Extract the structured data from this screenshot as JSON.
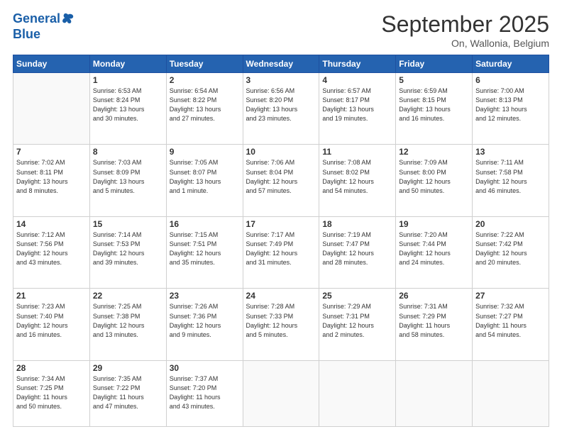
{
  "logo": {
    "line1": "General",
    "line2": "Blue"
  },
  "title": "September 2025",
  "subtitle": "On, Wallonia, Belgium",
  "weekdays": [
    "Sunday",
    "Monday",
    "Tuesday",
    "Wednesday",
    "Thursday",
    "Friday",
    "Saturday"
  ],
  "weeks": [
    [
      {
        "day": "",
        "info": ""
      },
      {
        "day": "1",
        "info": "Sunrise: 6:53 AM\nSunset: 8:24 PM\nDaylight: 13 hours\nand 30 minutes."
      },
      {
        "day": "2",
        "info": "Sunrise: 6:54 AM\nSunset: 8:22 PM\nDaylight: 13 hours\nand 27 minutes."
      },
      {
        "day": "3",
        "info": "Sunrise: 6:56 AM\nSunset: 8:20 PM\nDaylight: 13 hours\nand 23 minutes."
      },
      {
        "day": "4",
        "info": "Sunrise: 6:57 AM\nSunset: 8:17 PM\nDaylight: 13 hours\nand 19 minutes."
      },
      {
        "day": "5",
        "info": "Sunrise: 6:59 AM\nSunset: 8:15 PM\nDaylight: 13 hours\nand 16 minutes."
      },
      {
        "day": "6",
        "info": "Sunrise: 7:00 AM\nSunset: 8:13 PM\nDaylight: 13 hours\nand 12 minutes."
      }
    ],
    [
      {
        "day": "7",
        "info": "Sunrise: 7:02 AM\nSunset: 8:11 PM\nDaylight: 13 hours\nand 8 minutes."
      },
      {
        "day": "8",
        "info": "Sunrise: 7:03 AM\nSunset: 8:09 PM\nDaylight: 13 hours\nand 5 minutes."
      },
      {
        "day": "9",
        "info": "Sunrise: 7:05 AM\nSunset: 8:07 PM\nDaylight: 13 hours\nand 1 minute."
      },
      {
        "day": "10",
        "info": "Sunrise: 7:06 AM\nSunset: 8:04 PM\nDaylight: 12 hours\nand 57 minutes."
      },
      {
        "day": "11",
        "info": "Sunrise: 7:08 AM\nSunset: 8:02 PM\nDaylight: 12 hours\nand 54 minutes."
      },
      {
        "day": "12",
        "info": "Sunrise: 7:09 AM\nSunset: 8:00 PM\nDaylight: 12 hours\nand 50 minutes."
      },
      {
        "day": "13",
        "info": "Sunrise: 7:11 AM\nSunset: 7:58 PM\nDaylight: 12 hours\nand 46 minutes."
      }
    ],
    [
      {
        "day": "14",
        "info": "Sunrise: 7:12 AM\nSunset: 7:56 PM\nDaylight: 12 hours\nand 43 minutes."
      },
      {
        "day": "15",
        "info": "Sunrise: 7:14 AM\nSunset: 7:53 PM\nDaylight: 12 hours\nand 39 minutes."
      },
      {
        "day": "16",
        "info": "Sunrise: 7:15 AM\nSunset: 7:51 PM\nDaylight: 12 hours\nand 35 minutes."
      },
      {
        "day": "17",
        "info": "Sunrise: 7:17 AM\nSunset: 7:49 PM\nDaylight: 12 hours\nand 31 minutes."
      },
      {
        "day": "18",
        "info": "Sunrise: 7:19 AM\nSunset: 7:47 PM\nDaylight: 12 hours\nand 28 minutes."
      },
      {
        "day": "19",
        "info": "Sunrise: 7:20 AM\nSunset: 7:44 PM\nDaylight: 12 hours\nand 24 minutes."
      },
      {
        "day": "20",
        "info": "Sunrise: 7:22 AM\nSunset: 7:42 PM\nDaylight: 12 hours\nand 20 minutes."
      }
    ],
    [
      {
        "day": "21",
        "info": "Sunrise: 7:23 AM\nSunset: 7:40 PM\nDaylight: 12 hours\nand 16 minutes."
      },
      {
        "day": "22",
        "info": "Sunrise: 7:25 AM\nSunset: 7:38 PM\nDaylight: 12 hours\nand 13 minutes."
      },
      {
        "day": "23",
        "info": "Sunrise: 7:26 AM\nSunset: 7:36 PM\nDaylight: 12 hours\nand 9 minutes."
      },
      {
        "day": "24",
        "info": "Sunrise: 7:28 AM\nSunset: 7:33 PM\nDaylight: 12 hours\nand 5 minutes."
      },
      {
        "day": "25",
        "info": "Sunrise: 7:29 AM\nSunset: 7:31 PM\nDaylight: 12 hours\nand 2 minutes."
      },
      {
        "day": "26",
        "info": "Sunrise: 7:31 AM\nSunset: 7:29 PM\nDaylight: 11 hours\nand 58 minutes."
      },
      {
        "day": "27",
        "info": "Sunrise: 7:32 AM\nSunset: 7:27 PM\nDaylight: 11 hours\nand 54 minutes."
      }
    ],
    [
      {
        "day": "28",
        "info": "Sunrise: 7:34 AM\nSunset: 7:25 PM\nDaylight: 11 hours\nand 50 minutes."
      },
      {
        "day": "29",
        "info": "Sunrise: 7:35 AM\nSunset: 7:22 PM\nDaylight: 11 hours\nand 47 minutes."
      },
      {
        "day": "30",
        "info": "Sunrise: 7:37 AM\nSunset: 7:20 PM\nDaylight: 11 hours\nand 43 minutes."
      },
      {
        "day": "",
        "info": ""
      },
      {
        "day": "",
        "info": ""
      },
      {
        "day": "",
        "info": ""
      },
      {
        "day": "",
        "info": ""
      }
    ]
  ]
}
